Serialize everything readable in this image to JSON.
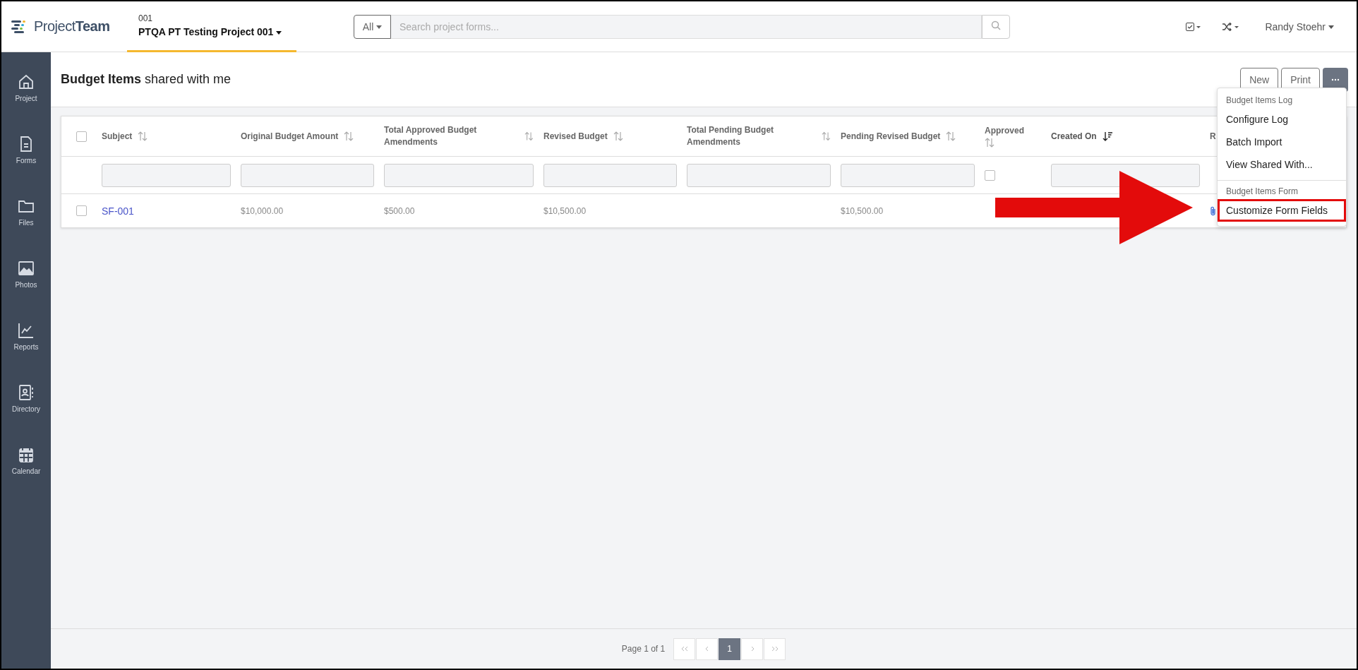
{
  "brand": {
    "name_light": "Project",
    "name_bold": "Team"
  },
  "project": {
    "code": "001",
    "name": "PTQA PT Testing Project 001"
  },
  "search": {
    "scope": "All",
    "placeholder": "Search project forms..."
  },
  "user": {
    "name": "Randy Stoehr"
  },
  "sidebar": {
    "items": [
      {
        "label": "Project"
      },
      {
        "label": "Forms"
      },
      {
        "label": "Files"
      },
      {
        "label": "Photos"
      },
      {
        "label": "Reports"
      },
      {
        "label": "Directory"
      },
      {
        "label": "Calendar"
      }
    ]
  },
  "page": {
    "title_bold": "Budget Items",
    "title_rest": "shared with me"
  },
  "actions": [
    "New",
    "Print"
  ],
  "menu": {
    "sections": [
      {
        "heading": "Budget Items Log",
        "items": [
          {
            "label": "Configure Log",
            "highlighted": false
          },
          {
            "label": "Batch Import",
            "highlighted": false
          },
          {
            "label": "View Shared With...",
            "highlighted": false
          }
        ]
      },
      {
        "heading": "Budget Items Form",
        "items": [
          {
            "label": "Customize Form Fields",
            "highlighted": true
          }
        ]
      }
    ]
  },
  "table": {
    "select_all": {
      "checked": false
    },
    "columns": [
      {
        "label": "Subject",
        "kind": "text",
        "sorted": false
      },
      {
        "label": "Original Budget Amount",
        "kind": "text",
        "sorted": false
      },
      {
        "label": "Total Approved Budget Amendments",
        "kind": "text",
        "sorted": false
      },
      {
        "label": "Revised Budget",
        "kind": "text",
        "sorted": false
      },
      {
        "label": "Total Pending Budget Amendments",
        "kind": "text",
        "sorted": false
      },
      {
        "label": "Pending Revised Budget",
        "kind": "text",
        "sorted": false
      },
      {
        "label": "Approved",
        "kind": "checkbox",
        "sorted": false,
        "filter_checked": false
      },
      {
        "label": "Created On",
        "kind": "text",
        "sorted": true
      },
      {
        "label": "R",
        "kind": "partial"
      }
    ],
    "rows": [
      {
        "checked": false,
        "cells": [
          "SF-001",
          "$10,000.00",
          "$500.00",
          "$10,500.00",
          "",
          "$10,500.00",
          "",
          "",
          ""
        ],
        "attachment": true
      }
    ]
  },
  "pagination": {
    "label": "Page 1 of 1",
    "pages": [
      {
        "label": "1",
        "selected": true
      }
    ]
  }
}
